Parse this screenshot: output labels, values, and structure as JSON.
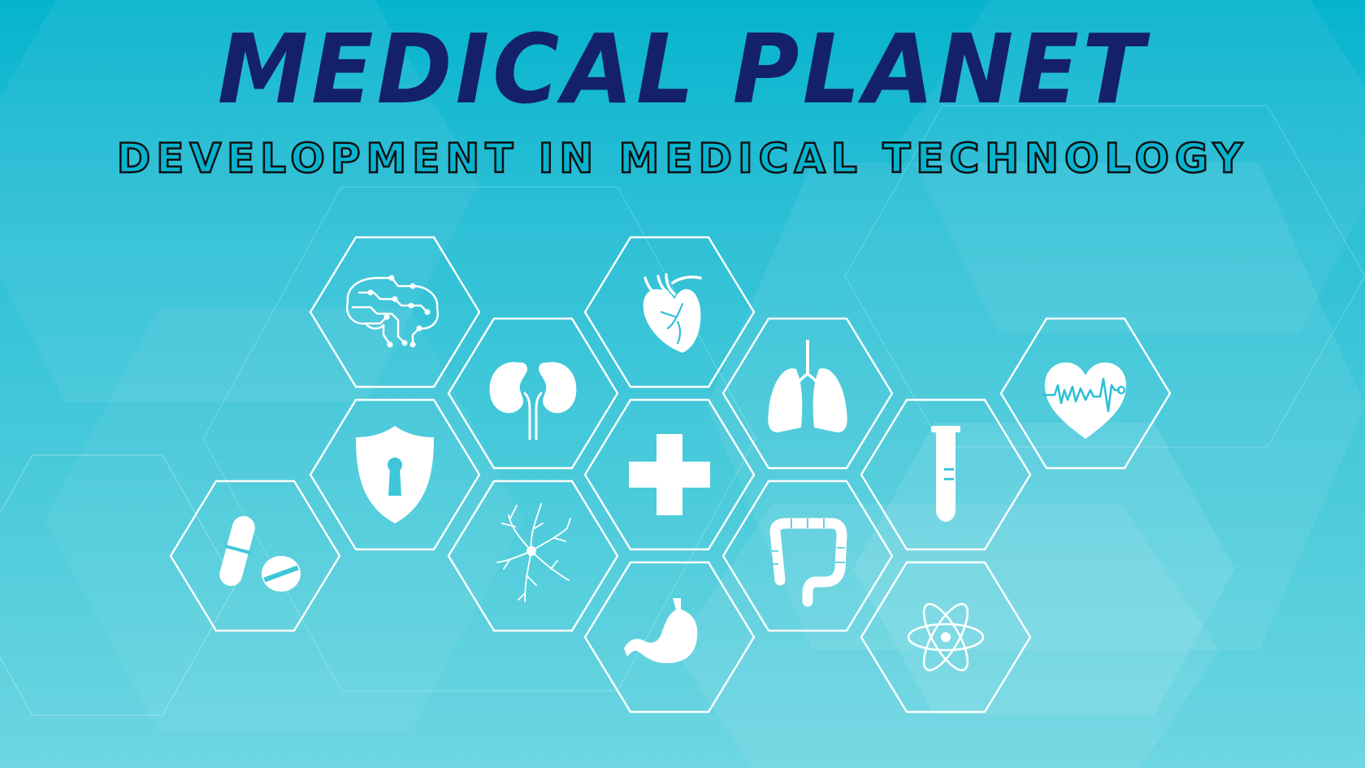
{
  "title": "MEDICAL PLANET",
  "subtitle": "DEVELOPMENT IN MEDICAL TECHNOLOGY",
  "colors": {
    "title": "#14216a",
    "subtitle_outline": "#101010",
    "background_top": "#06b3cf",
    "background_bottom": "#6dd6e1",
    "icon": "#ffffff"
  },
  "icons": [
    "brain-circuit-icon",
    "kidneys-icon",
    "heart-icon",
    "lungs-icon",
    "heartbeat-icon",
    "shield-lock-icon",
    "medical-cross-icon",
    "test-tube-icon",
    "pills-icon",
    "neuron-icon",
    "intestine-icon",
    "stomach-icon",
    "atom-icon"
  ]
}
